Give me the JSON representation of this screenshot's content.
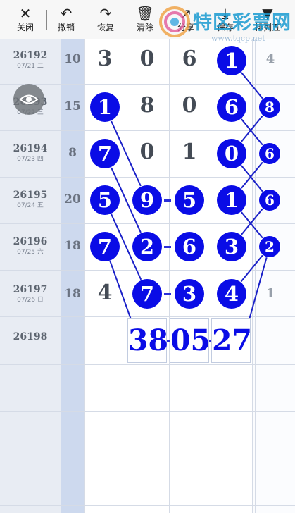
{
  "toolbar": {
    "close_label": "关闭",
    "undo_label": "撤销",
    "redo_label": "恢复",
    "clear_label": "清除",
    "share_label": "分享",
    "save_label": "保存",
    "layout_label": "排列五"
  },
  "watermark": {
    "title": "特区彩票网",
    "url": "www.tqcp.net"
  },
  "rows": [
    {
      "issue": "26192",
      "date": "07/21 二",
      "sum": "10",
      "last": "4"
    },
    {
      "issue": "26193",
      "date": "07/22 三",
      "sum": "15",
      "last": ""
    },
    {
      "issue": "26194",
      "date": "07/23 四",
      "sum": "8",
      "last": ""
    },
    {
      "issue": "26195",
      "date": "07/24 五",
      "sum": "20",
      "last": ""
    },
    {
      "issue": "26196",
      "date": "07/25 六",
      "sum": "18",
      "last": ""
    },
    {
      "issue": "26197",
      "date": "07/26 日",
      "sum": "18",
      "last": "1"
    },
    {
      "issue": "26198",
      "date": "",
      "sum": "",
      "last": ""
    }
  ],
  "grid_values": {
    "r1": [
      "3",
      "0",
      "6",
      "1"
    ],
    "r2": [
      "1",
      "8",
      "0",
      "6",
      "8"
    ],
    "r3": [
      "7",
      "0",
      "1",
      "0",
      "6"
    ],
    "r4": [
      "5",
      "9",
      "5",
      "1",
      "6"
    ],
    "r5": [
      "7",
      "2",
      "6",
      "3",
      "2"
    ],
    "r6": [
      "4",
      "7",
      "3",
      "4"
    ]
  },
  "prediction": [
    "38",
    "05",
    "27"
  ],
  "colors": {
    "ball": "#0a0ce6",
    "line": "#1a20c8",
    "sum_column": "#cdd9ee",
    "issue_column": "#e8ecf3"
  }
}
